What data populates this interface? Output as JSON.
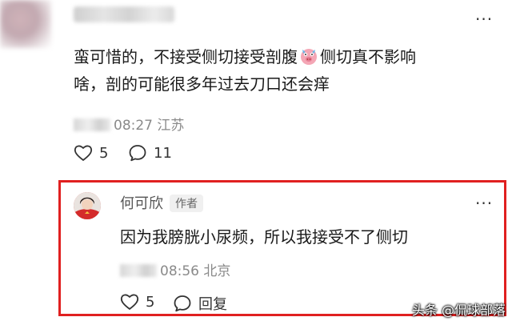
{
  "main_comment": {
    "line1": "蛮可惜的，不接受侧切接受剖腹",
    "line1_after": "侧切真不影响",
    "line2": "啥，剖的可能很多年过去刀口还会痒",
    "time": "08:27",
    "location": "江苏",
    "likes": "5",
    "comments": "11"
  },
  "reply": {
    "author": "何可欣",
    "author_tag": "作者",
    "text": "因为我膀胱小尿频，所以我接受不了侧切",
    "time": "08:56",
    "location": "北京",
    "likes": "5",
    "reply_label": "回复"
  },
  "watermark": "头条 @侃球部落",
  "colors": {
    "highlight_border": "#e02020",
    "meta_gray": "#8a8a8a"
  }
}
